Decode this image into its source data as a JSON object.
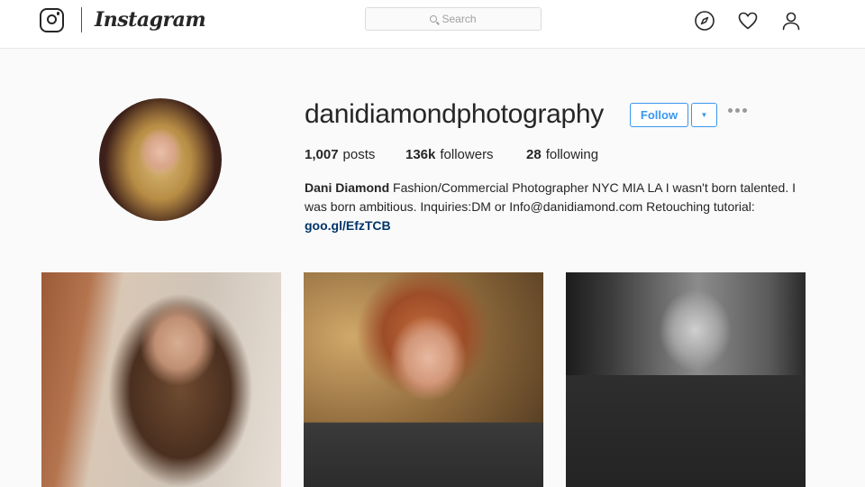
{
  "nav": {
    "brand": "Instagram",
    "search_placeholder": "Search",
    "icons": [
      "instagram-logo-icon",
      "explore-compass-icon",
      "heart-activity-icon",
      "profile-person-icon"
    ]
  },
  "profile": {
    "username": "danidiamondphotography",
    "follow_label": "Follow",
    "dropdown_glyph": "▼",
    "stats": {
      "posts_count": "1,007",
      "posts_label": "posts",
      "followers_count": "136k",
      "followers_label": "followers",
      "following_count": "28",
      "following_label": "following"
    },
    "bio": {
      "name": "Dani Diamond",
      "text": " Fashion/Commercial Photographer NYC MIA LA I wasn't born talented. I was born ambitious. Inquiries:DM or Info@danidiamond.com Retouching tutorial: ",
      "link": "goo.gl/EfzTCB"
    }
  },
  "colors": {
    "accent": "#3897f0",
    "link": "#003569",
    "text": "#262626",
    "background": "#fafafa"
  }
}
